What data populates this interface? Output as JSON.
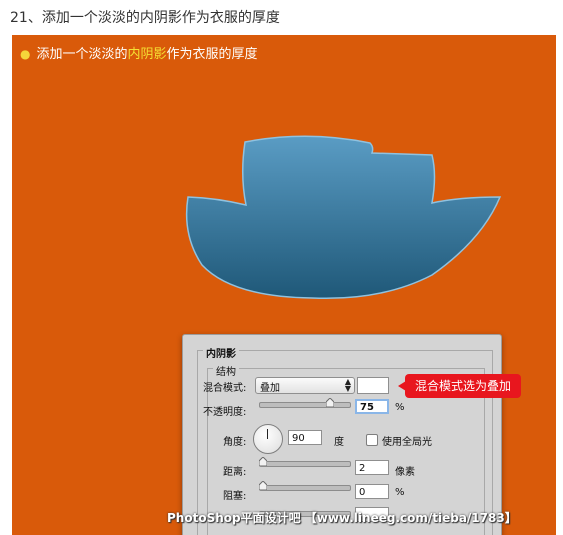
{
  "step_title": "21、添加一个淡淡的内阴影作为衣服的厚度",
  "bullet": {
    "prefix": "添加一个淡淡的",
    "highlight": "内阴影",
    "suffix": "作为衣服的厚度"
  },
  "colors": {
    "background_orange": "#d95a0a",
    "highlight_yellow": "#f5e133",
    "shape_top": "#5a9cc4",
    "shape_bottom": "#1f5878",
    "callout_red": "#e8161e"
  },
  "dialog": {
    "group_title": "内阴影",
    "sub_title": "结构",
    "blend_mode_label": "混合模式:",
    "blend_mode_value": "叠加",
    "opacity_label": "不透明度:",
    "opacity_value": "75",
    "opacity_unit": "%",
    "angle_label": "角度:",
    "angle_value": "90",
    "angle_unit": "度",
    "global_light_label": "使用全局光",
    "distance_label": "距离:",
    "distance_value": "2",
    "distance_unit": "像素",
    "choke_label": "阻塞:",
    "choke_value": "0",
    "choke_unit": "%"
  },
  "callout_text": "混合模式选为叠加",
  "watermark": "PhotoShop平面设计吧 【www.lineeg.com/tieba/1783】"
}
